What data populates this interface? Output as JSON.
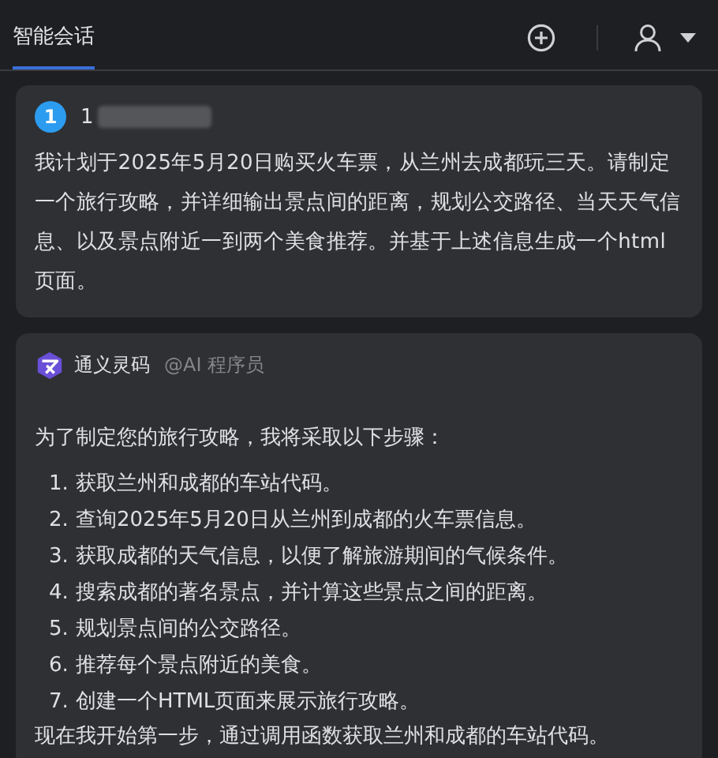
{
  "tabs": [
    {
      "label": "智能会话",
      "selected": true
    }
  ],
  "user_message": {
    "avatar": "1",
    "name": "1",
    "text": "我计划于2025年5月20日购买火车票，从兰州去成都玩三天。请制定一个旅行攻略，并详细输出景点间的距离，规划公交路径、当天天气信息、以及景点附近一到两个美食推荐。并基于上述信息生成一个html页面。"
  },
  "assistant_message": {
    "name": "通义灵码",
    "role": "@AI 程序员",
    "intro": "为了制定您的旅行攻略，我将采取以下步骤：",
    "steps": [
      {
        "number": "1.",
        "text": "获取兰州和成都的车站代码。"
      },
      {
        "number": "2.",
        "text": "查询2025年5月20日从兰州到成都的火车票信息。"
      },
      {
        "number": "3.",
        "text": "获取成都的天气信息，以便了解旅游期间的气候条件。"
      },
      {
        "number": "4.",
        "text": "搜索成都的著名景点，并计算这些景点之间的距离。"
      },
      {
        "number": "5.",
        "text": "规划景点间的公交路径。"
      },
      {
        "number": "6.",
        "text": "推荐每个景点附近的美食。"
      },
      {
        "number": "7.",
        "text": "创建一个HTML页面来展示旅行攻略。"
      }
    ],
    "outro": "现在我开始第一步，通过调用函数获取兰州和成都的车站代码。"
  }
}
